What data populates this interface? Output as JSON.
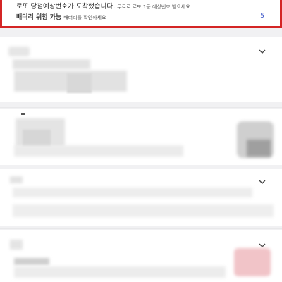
{
  "highlight": {
    "title": "로또 당첨예상번호가 도착했습니다.",
    "title_sub": "무료로 로또 1등 예상번호 받으세요.",
    "battery_title": "배터리 위험 가능",
    "battery_sub": "배터리를 확인하세요",
    "count": "5",
    "border_color": "#d42525"
  },
  "icons": {
    "expand": "chevron-down-icon"
  }
}
